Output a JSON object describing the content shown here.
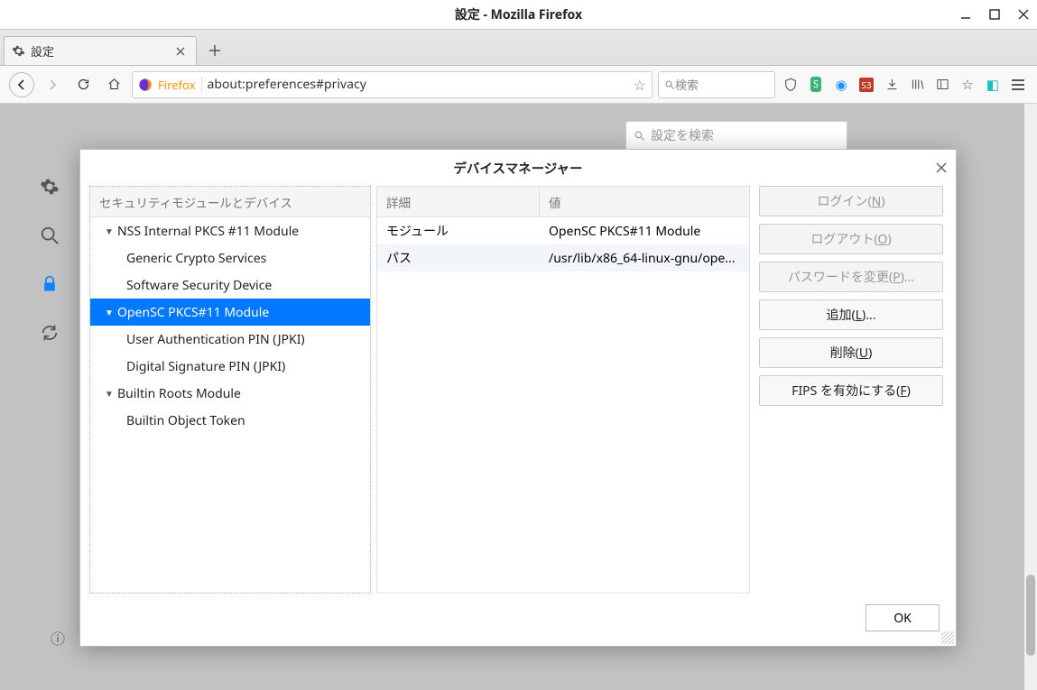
{
  "window": {
    "title": "設定 - Mozilla Firefox"
  },
  "tab": {
    "label": "設定"
  },
  "urlbar": {
    "brand": "Firefox",
    "url": "about:preferences#privacy"
  },
  "searchbox": {
    "placeholder": "検索"
  },
  "prefs_search": {
    "placeholder": "設定を検索"
  },
  "dialog": {
    "title": "デバイスマネージャー",
    "tree_header": "セキュリティモジュールとデバイス",
    "detail_header": "詳細",
    "value_header": "値",
    "items": [
      {
        "label": "NSS Internal PKCS #11 Module",
        "depth": 0,
        "expandable": true
      },
      {
        "label": "Generic Crypto Services",
        "depth": 1
      },
      {
        "label": "Software Security Device",
        "depth": 1
      },
      {
        "label": "OpenSC PKCS#11 Module",
        "depth": 0,
        "expandable": true,
        "selected": true
      },
      {
        "label": "User Authentication PIN (JPKI)",
        "depth": 1
      },
      {
        "label": "Digital Signature PIN (JPKI)",
        "depth": 1
      },
      {
        "label": "Builtin Roots Module",
        "depth": 0,
        "expandable": true
      },
      {
        "label": "Builtin Object Token",
        "depth": 1
      }
    ],
    "details": {
      "module_label": "モジュール",
      "module_value": "OpenSC PKCS#11 Module",
      "path_label": "パス",
      "path_value": "/usr/lib/x86_64-linux-gnu/ope..."
    },
    "buttons": {
      "login": {
        "text": "ログイン(",
        "access": "N",
        "suffix": ")"
      },
      "logout": {
        "text": "ログアウト(",
        "access": "O",
        "suffix": ")"
      },
      "changepw": {
        "text": "パスワードを変更(",
        "access": "P",
        "suffix": ")..."
      },
      "load": {
        "text": "追加(",
        "access": "L",
        "suffix": ")..."
      },
      "unload": {
        "text": "削除(",
        "access": "U",
        "suffix": ")"
      },
      "fips": {
        "text": "FIPS を有効にする(",
        "access": "F",
        "suffix": ")"
      }
    },
    "ok": "OK"
  }
}
